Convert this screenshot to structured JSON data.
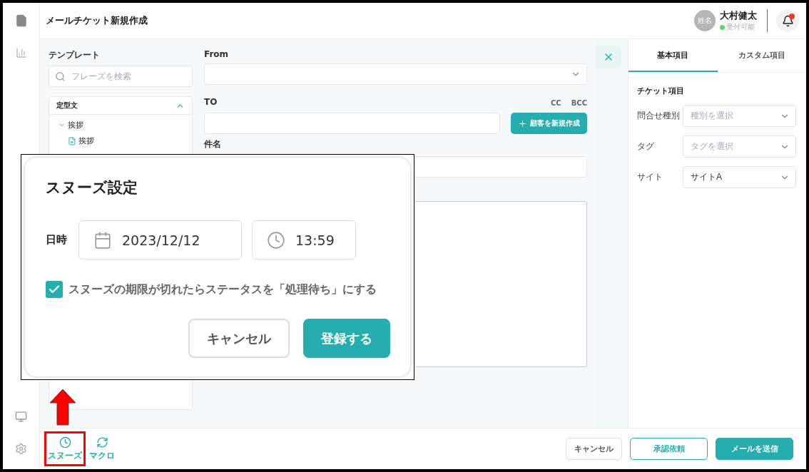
{
  "app": {
    "title": "メールチケット新規作成"
  },
  "user": {
    "avatar": "姓名",
    "name": "大村健太",
    "status": "受付可能",
    "online": true
  },
  "notifications": {
    "unread": true
  },
  "template": {
    "label": "テンプレート",
    "search_placeholder": "フレーズを検索",
    "group": {
      "title": "定型文",
      "expanded": true,
      "children": [
        {
          "label": "挨拶",
          "expanded": true,
          "children": [
            {
              "label": "挨拶"
            }
          ]
        }
      ]
    }
  },
  "compose": {
    "from_label": "From",
    "to_label": "TO",
    "cc": "CC",
    "bcc": "BCC",
    "new_customer": "顧客を新規作成",
    "subject_label": "件名"
  },
  "side_panel": {
    "tabs": [
      {
        "label": "基本項目",
        "selected": true
      },
      {
        "label": "カスタム項目",
        "selected": false
      }
    ],
    "section": "チケット項目",
    "fields": [
      {
        "label": "問合せ種別",
        "placeholder": "種別を選択"
      },
      {
        "label": "タグ",
        "placeholder": "タグを選択"
      },
      {
        "label": "サイト",
        "value": "サイトA"
      }
    ]
  },
  "footer": {
    "tools": [
      {
        "kind": "snooze",
        "label": "スヌーズ",
        "highlighted": true
      },
      {
        "kind": "macro",
        "label": "マクロ",
        "highlighted": false
      }
    ],
    "buttons": [
      {
        "kind": "plain",
        "label": "キャンセル"
      },
      {
        "kind": "outline",
        "label": "承認依頼"
      },
      {
        "kind": "primary",
        "label": "メールを送信"
      }
    ]
  },
  "snooze_dialog": {
    "title": "スヌーズ設定",
    "datetime_label": "日時",
    "date": "2023/12/12",
    "time": "13:59",
    "checkbox": {
      "label": "スヌーズの期限が切れたらステータスを「処理待ち」にする",
      "checked": true
    },
    "buttons": [
      {
        "kind": "plain",
        "label": "キャンセル"
      },
      {
        "kind": "primary",
        "label": "登録する"
      }
    ]
  }
}
